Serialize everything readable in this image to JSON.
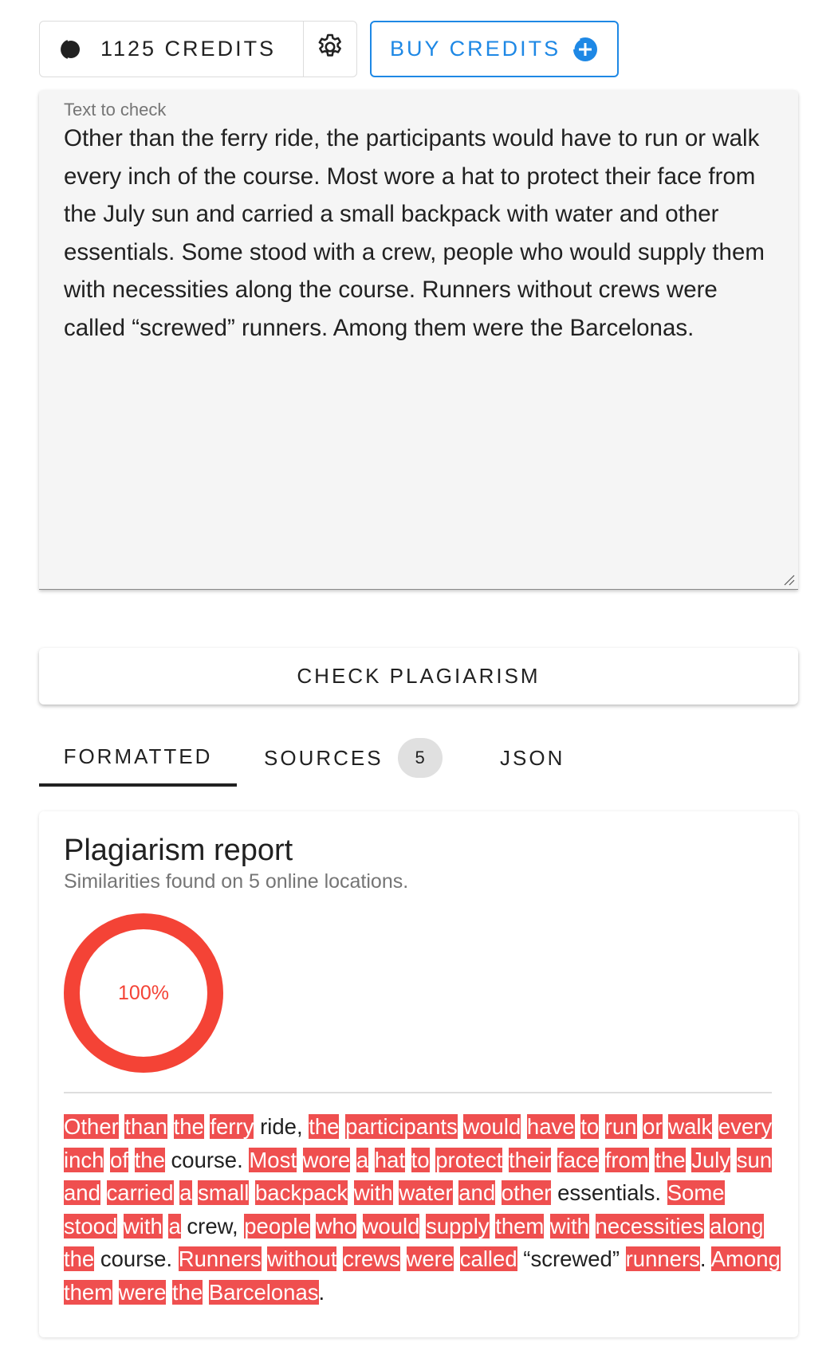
{
  "topbar": {
    "credits_label": "1125 CREDITS",
    "buy_label": "BUY CREDITS",
    "accent_color": "#1e88e5"
  },
  "input": {
    "label": "Text to check",
    "value": "Other than the ferry ride, the participants would have to run or walk every inch of the course. Most wore a hat to protect their face from the July sun and carried a small backpack with water and other essentials. Some stood with a crew, people who would supply them with necessities along the course. Runners without crews were called “screwed” runners. Among them were the Barcelonas."
  },
  "check_button": {
    "label": "CHECK PLAGIARISM"
  },
  "tabs": [
    {
      "label": "FORMATTED",
      "active": true
    },
    {
      "label": "SOURCES",
      "badge": "5"
    },
    {
      "label": "JSON"
    }
  ],
  "report": {
    "title": "Plagiarism report",
    "subtitle": "Similarities found on 5 online locations.",
    "score_label": "100%",
    "score_fraction": 1.0,
    "highlight_color": "#ef4f4f",
    "segments": [
      {
        "t": "Other",
        "h": true
      },
      {
        "t": " "
      },
      {
        "t": "than",
        "h": true
      },
      {
        "t": " "
      },
      {
        "t": "the",
        "h": true
      },
      {
        "t": " "
      },
      {
        "t": "ferry",
        "h": true
      },
      {
        "t": " ride, "
      },
      {
        "t": "the",
        "h": true
      },
      {
        "t": " "
      },
      {
        "t": "participants",
        "h": true
      },
      {
        "t": " "
      },
      {
        "t": "would",
        "h": true
      },
      {
        "t": " "
      },
      {
        "t": "have",
        "h": true
      },
      {
        "t": " "
      },
      {
        "t": "to",
        "h": true
      },
      {
        "t": " "
      },
      {
        "t": "run",
        "h": true
      },
      {
        "t": " "
      },
      {
        "t": "or",
        "h": true
      },
      {
        "t": " "
      },
      {
        "t": "walk",
        "h": true
      },
      {
        "t": " "
      },
      {
        "t": "every",
        "h": true
      },
      {
        "t": " "
      },
      {
        "t": "inch",
        "h": true
      },
      {
        "t": " "
      },
      {
        "t": "of",
        "h": true
      },
      {
        "t": " "
      },
      {
        "t": "the",
        "h": true
      },
      {
        "t": " course. "
      },
      {
        "t": "Most",
        "h": true
      },
      {
        "t": " "
      },
      {
        "t": "wore",
        "h": true
      },
      {
        "t": " "
      },
      {
        "t": "a",
        "h": true
      },
      {
        "t": " "
      },
      {
        "t": "hat",
        "h": true
      },
      {
        "t": " "
      },
      {
        "t": "to",
        "h": true
      },
      {
        "t": " "
      },
      {
        "t": "protect",
        "h": true
      },
      {
        "t": " "
      },
      {
        "t": "their",
        "h": true
      },
      {
        "t": " "
      },
      {
        "t": "face",
        "h": true
      },
      {
        "t": " "
      },
      {
        "t": "from",
        "h": true
      },
      {
        "t": " "
      },
      {
        "t": "the",
        "h": true
      },
      {
        "t": " "
      },
      {
        "t": "July",
        "h": true
      },
      {
        "t": " "
      },
      {
        "t": "sun",
        "h": true
      },
      {
        "t": " "
      },
      {
        "t": "and",
        "h": true
      },
      {
        "t": " "
      },
      {
        "t": "carried",
        "h": true
      },
      {
        "t": " "
      },
      {
        "t": "a",
        "h": true
      },
      {
        "t": " "
      },
      {
        "t": "small",
        "h": true
      },
      {
        "t": " "
      },
      {
        "t": "backpack",
        "h": true
      },
      {
        "t": " "
      },
      {
        "t": "with",
        "h": true
      },
      {
        "t": " "
      },
      {
        "t": "water",
        "h": true
      },
      {
        "t": " "
      },
      {
        "t": "and",
        "h": true
      },
      {
        "t": " "
      },
      {
        "t": "other",
        "h": true
      },
      {
        "t": " essentials. "
      },
      {
        "t": "Some",
        "h": true
      },
      {
        "t": " "
      },
      {
        "t": "stood",
        "h": true
      },
      {
        "t": " "
      },
      {
        "t": "with",
        "h": true
      },
      {
        "t": " "
      },
      {
        "t": "a",
        "h": true
      },
      {
        "t": " crew, "
      },
      {
        "t": "people",
        "h": true
      },
      {
        "t": " "
      },
      {
        "t": "who",
        "h": true
      },
      {
        "t": " "
      },
      {
        "t": "would",
        "h": true
      },
      {
        "t": " "
      },
      {
        "t": "supply",
        "h": true
      },
      {
        "t": " "
      },
      {
        "t": "them",
        "h": true
      },
      {
        "t": " "
      },
      {
        "t": "with",
        "h": true
      },
      {
        "t": " "
      },
      {
        "t": "necessities",
        "h": true
      },
      {
        "t": " "
      },
      {
        "t": "along",
        "h": true
      },
      {
        "t": " "
      },
      {
        "t": "the",
        "h": true
      },
      {
        "t": " course. "
      },
      {
        "t": "Runners",
        "h": true
      },
      {
        "t": " "
      },
      {
        "t": "without",
        "h": true
      },
      {
        "t": " "
      },
      {
        "t": "crews",
        "h": true
      },
      {
        "t": " "
      },
      {
        "t": "were",
        "h": true
      },
      {
        "t": " "
      },
      {
        "t": "called",
        "h": true
      },
      {
        "t": " “screwed” "
      },
      {
        "t": "runners",
        "h": true
      },
      {
        "t": ". "
      },
      {
        "t": "Among",
        "h": true
      },
      {
        "t": " "
      },
      {
        "t": "them",
        "h": true
      },
      {
        "t": " "
      },
      {
        "t": "were",
        "h": true
      },
      {
        "t": " "
      },
      {
        "t": "the",
        "h": true
      },
      {
        "t": " "
      },
      {
        "t": "Barcelonas",
        "h": true
      },
      {
        "t": "."
      }
    ]
  }
}
